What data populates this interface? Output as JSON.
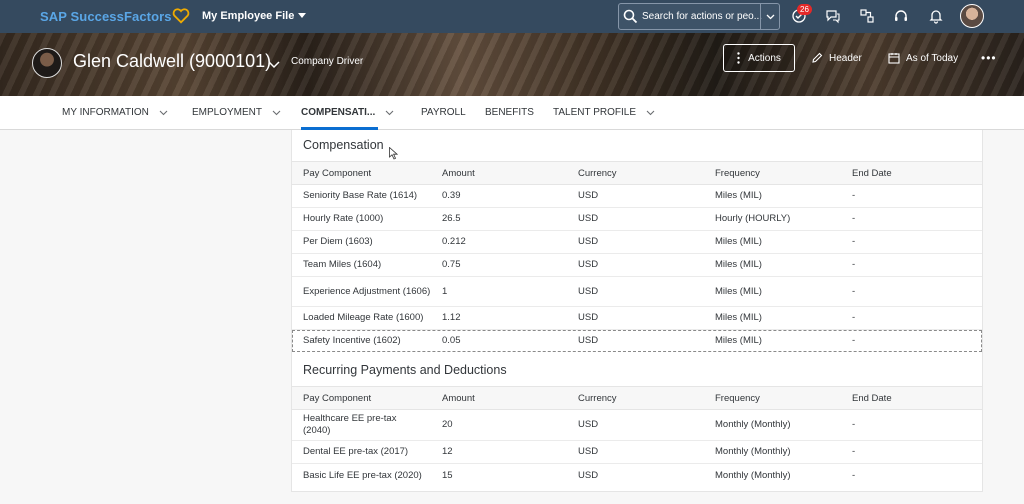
{
  "shell": {
    "logo": "SAP SuccessFactors",
    "app_title": "My Employee File",
    "search_placeholder": "Search for actions or peo...",
    "notification_count": "26"
  },
  "employee": {
    "name": "Glen Caldwell (9000101)",
    "job_title": "Company Driver"
  },
  "header_actions": {
    "actions_label": "Actions",
    "header_label": "Header",
    "as_of_label": "As of Today",
    "more_label": "•••"
  },
  "tabs": [
    {
      "label": "MY INFORMATION"
    },
    {
      "label": "EMPLOYMENT"
    },
    {
      "label": "COMPENSATI..."
    },
    {
      "label": "PAYROLL"
    },
    {
      "label": "BENEFITS"
    },
    {
      "label": "TALENT PROFILE"
    }
  ],
  "compensation": {
    "title": "Compensation",
    "columns": [
      "Pay Component",
      "Amount",
      "Currency",
      "Frequency",
      "End Date"
    ],
    "rows": [
      [
        "Seniority Base Rate (1614)",
        "0.39",
        "USD",
        "Miles (MIL)",
        "-"
      ],
      [
        "Hourly Rate (1000)",
        "26.5",
        "USD",
        "Hourly (HOURLY)",
        "-"
      ],
      [
        "Per Diem (1603)",
        "0.212",
        "USD",
        "Miles (MIL)",
        "-"
      ],
      [
        "Team Miles (1604)",
        "0.75",
        "USD",
        "Miles (MIL)",
        "-"
      ],
      [
        "Experience Adjustment (1606)",
        "1",
        "USD",
        "Miles (MIL)",
        "-"
      ],
      [
        "Loaded Mileage Rate (1600)",
        "1.12",
        "USD",
        "Miles (MIL)",
        "-"
      ],
      [
        "Safety Incentive (1602)",
        "0.05",
        "USD",
        "Miles (MIL)",
        "-"
      ]
    ]
  },
  "recurring": {
    "title": "Recurring Payments and Deductions",
    "columns": [
      "Pay Component",
      "Amount",
      "Currency",
      "Frequency",
      "End Date"
    ],
    "rows": [
      [
        "Healthcare EE pre-tax (2040)",
        "20",
        "USD",
        "Monthly (Monthly)",
        "-"
      ],
      [
        "Dental EE pre-tax (2017)",
        "12",
        "USD",
        "Monthly (Monthly)",
        "-"
      ],
      [
        "Basic Life EE pre-tax (2020)",
        "15",
        "USD",
        "Monthly (Monthly)",
        "-"
      ]
    ]
  }
}
